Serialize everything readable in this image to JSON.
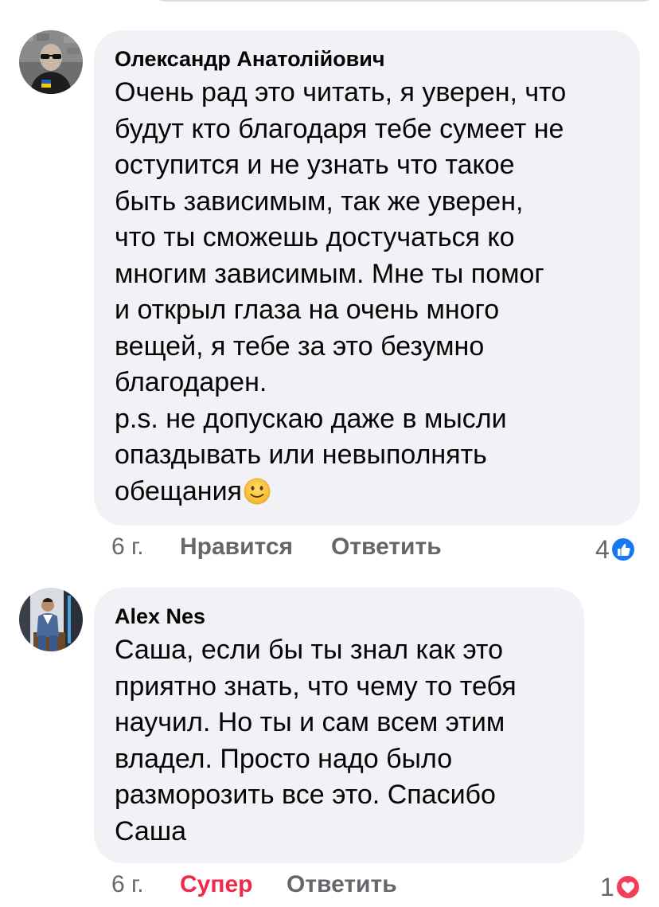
{
  "comments": [
    {
      "author": "Олександр Анатолійович",
      "text": "Очень рад это читать, я уверен, что\nбудут кто благодаря тебе сумеет не\nоступится и не узнать что такое\nбыть зависимым, так же уверен,\nчто ты сможешь достучаться ко\nмногим зависимым. Мне ты помог\nи открыл глаза на очень много\nвещей, я тебе за это безумно\nблагодарен.\np.s. не допускаю даже в мысли\nопаздывать или невыполнять\nобещания",
      "emoji": "slightly-smiling-face-icon",
      "time": "6 г.",
      "like_label": "Нравится",
      "reply_label": "Ответить",
      "reaction_count": "4",
      "reaction_icon": "like-icon",
      "reaction_color": "#1877f2"
    },
    {
      "author": "Alex Nes",
      "text": "Саша, если бы ты знал как это\nприятно знать, что чему то тебя\nнаучил. Но ты и сам всем этим\nвладел. Просто надо было\nразморозить все это. Спасибо\nСаша",
      "time": "6 г.",
      "like_label": "Супер",
      "like_color": "#f02849",
      "reply_label": "Ответить",
      "reaction_count": "1",
      "reaction_icon": "love-icon",
      "reaction_color": "#f33e58"
    }
  ]
}
